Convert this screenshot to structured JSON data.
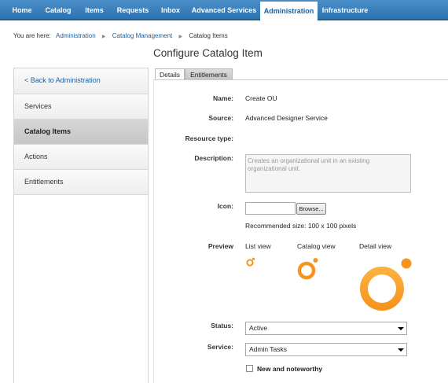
{
  "nav": {
    "tabs": [
      "Home",
      "Catalog",
      "Items",
      "Requests",
      "Inbox",
      "Advanced Services",
      "Administration",
      "Infrastructure"
    ],
    "active": "Administration"
  },
  "breadcrumb": {
    "prefix": "You are here:",
    "items": [
      "Administration",
      "Catalog Management",
      "Catalog Items"
    ]
  },
  "page_title": "Configure Catalog Item",
  "sidebar": {
    "back": "< Back to Administration",
    "items": [
      "Services",
      "Catalog Items",
      "Actions",
      "Entitlements"
    ],
    "active": "Catalog Items"
  },
  "tabs": {
    "details": "Details",
    "entitlements": "Entitlements"
  },
  "form": {
    "name_label": "Name:",
    "name_value": "Create OU",
    "source_label": "Source:",
    "source_value": "Advanced Designer Service",
    "resource_type_label": "Resource type:",
    "description_label": "Description:",
    "description_value": "Creates an organizational unit in an existing organizational unit.",
    "icon_label": "Icon:",
    "browse_label": "Browse...",
    "icon_hint": "Recommended size: 100 x 100 pixels",
    "preview_label": "Preview",
    "list_view": "List view",
    "catalog_view": "Catalog view",
    "detail_view": "Detail view",
    "status_label": "Status:",
    "status_value": "Active",
    "service_label": "Service:",
    "service_value": "Admin Tasks",
    "new_noteworthy": "New and noteworthy"
  },
  "colors": {
    "nav_blue": "#2e72b0",
    "orange": "#f7941d"
  }
}
